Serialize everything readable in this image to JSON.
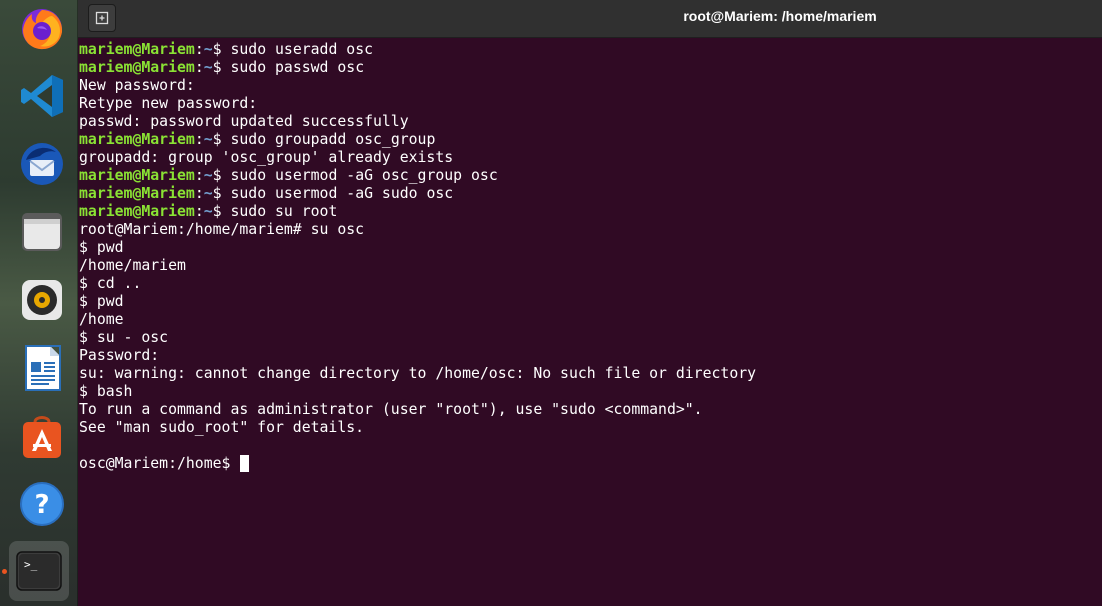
{
  "window": {
    "title": "root@Mariem: /home/mariem",
    "new_tab_icon": "new-tab-icon"
  },
  "dock": {
    "items": [
      {
        "name": "firefox",
        "icon": "firefox-icon"
      },
      {
        "name": "vscode",
        "icon": "vscode-icon"
      },
      {
        "name": "thunderbird",
        "icon": "thunderbird-icon"
      },
      {
        "name": "files",
        "icon": "files-icon"
      },
      {
        "name": "rhythmbox",
        "icon": "rhythmbox-icon"
      },
      {
        "name": "libreoffice-writer",
        "icon": "writer-icon"
      },
      {
        "name": "software",
        "icon": "software-icon"
      },
      {
        "name": "help",
        "icon": "help-icon",
        "glyph": "?"
      },
      {
        "name": "terminal",
        "icon": "terminal-icon",
        "glyph": ">_",
        "active": true
      }
    ]
  },
  "terminal": {
    "prompt_user": "mariem@Mariem",
    "prompt_path": "~",
    "lines": [
      {
        "type": "prompt",
        "cmd": "sudo useradd osc"
      },
      {
        "type": "prompt",
        "cmd": "sudo passwd osc"
      },
      {
        "type": "out",
        "text": "New password:"
      },
      {
        "type": "out",
        "text": "Retype new password:"
      },
      {
        "type": "out",
        "text": "passwd: password updated successfully"
      },
      {
        "type": "prompt",
        "cmd": "sudo groupadd osc_group"
      },
      {
        "type": "out",
        "text": "groupadd: group 'osc_group' already exists"
      },
      {
        "type": "prompt",
        "cmd": "sudo usermod -aG osc_group osc"
      },
      {
        "type": "prompt",
        "cmd": "sudo usermod -aG sudo osc"
      },
      {
        "type": "prompt",
        "cmd": "sudo su root"
      },
      {
        "type": "out",
        "text": "root@Mariem:/home/mariem# su osc"
      },
      {
        "type": "out",
        "text": "$ pwd"
      },
      {
        "type": "out",
        "text": "/home/mariem"
      },
      {
        "type": "out",
        "text": "$ cd .."
      },
      {
        "type": "out",
        "text": "$ pwd"
      },
      {
        "type": "out",
        "text": "/home"
      },
      {
        "type": "out",
        "text": "$ su - osc"
      },
      {
        "type": "out",
        "text": "Password:"
      },
      {
        "type": "out",
        "text": "su: warning: cannot change directory to /home/osc: No such file or directory"
      },
      {
        "type": "out",
        "text": "$ bash"
      },
      {
        "type": "out",
        "text": "To run a command as administrator (user \"root\"), use \"sudo <command>\"."
      },
      {
        "type": "out",
        "text": "See \"man sudo_root\" for details."
      },
      {
        "type": "out",
        "text": ""
      },
      {
        "type": "cursor",
        "text": "osc@Mariem:/home$ "
      }
    ]
  },
  "colors": {
    "background": "#300a24",
    "prompt_user": "#8ae234",
    "prompt_path": "#729fcf",
    "text": "#ffffff"
  }
}
